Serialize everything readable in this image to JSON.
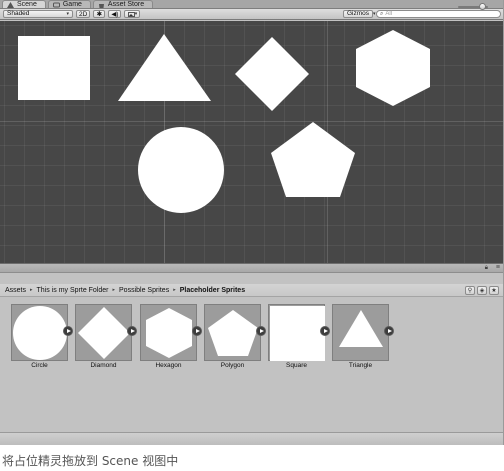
{
  "tabs": [
    {
      "label": "Scene",
      "icon": "scene-icon",
      "active": true
    },
    {
      "label": "Game",
      "icon": "game-icon",
      "active": false
    },
    {
      "label": "Asset Store",
      "icon": "store-icon",
      "active": false
    }
  ],
  "toolbar": {
    "shading_mode": "Shaded",
    "render_mode": "2D",
    "lighting_icon": "sun-icon",
    "audio_icon": "speaker-icon",
    "effects_icon": "image-icon",
    "gizmos_label": "Gizmos",
    "search_placeholder": "All"
  },
  "scene_objects": [
    "square",
    "triangle",
    "diamond",
    "hexagon",
    "circle",
    "pentagon"
  ],
  "breadcrumb": [
    "Assets",
    "This is my Sprte Folder",
    "Possible Sprites",
    "Placeholder Sprites"
  ],
  "assets": [
    {
      "name": "Circle",
      "shape": "circle"
    },
    {
      "name": "Diamond",
      "shape": "diamond"
    },
    {
      "name": "Hexagon",
      "shape": "hexagon"
    },
    {
      "name": "Polygon",
      "shape": "pentagon"
    },
    {
      "name": "Square",
      "shape": "square"
    },
    {
      "name": "Triangle",
      "shape": "triangle"
    }
  ],
  "zoom_slider": {
    "value": 0.8
  },
  "caption": "将占位精灵拖放到 Scene 视图中",
  "colors": {
    "scene_bg": "#474747",
    "panel_bg": "#c2c2c2",
    "sprite_fill": "#ffffff",
    "thumb_bg": "#9c9c9c"
  }
}
